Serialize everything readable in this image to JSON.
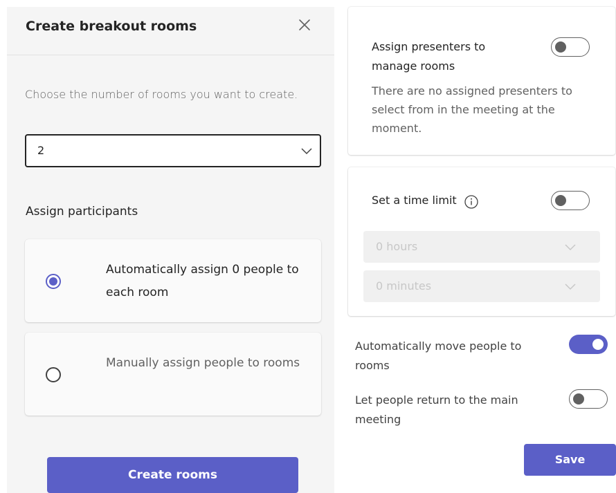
{
  "left_panel": {
    "title": "Create breakout rooms",
    "prompt": "Choose the number of rooms you want to create.",
    "room_count": "2",
    "assign_heading": "Assign participants",
    "options": [
      {
        "label": "Automatically assign 0 people to each room",
        "selected": true
      },
      {
        "label": "Manually assign people to rooms",
        "selected": false
      }
    ],
    "create_button": "Create rooms"
  },
  "right_panel": {
    "presenters": {
      "label": "Assign presenters to manage rooms",
      "enabled": false,
      "description": "There are no assigned presenters to select from in the meeting at the moment."
    },
    "time_limit": {
      "label": "Set a time limit",
      "enabled": false,
      "hours": "0 hours",
      "minutes": "0 minutes"
    },
    "auto_move": {
      "label": "Automatically move people to rooms",
      "enabled": true
    },
    "return_main": {
      "label": "Let people return to the main meeting",
      "enabled": false
    },
    "save_button": "Save"
  },
  "colors": {
    "accent": "#5b5fc7",
    "panel_bg": "#f5f5f5",
    "text_primary": "#242424",
    "text_secondary": "#616161",
    "disabled_bg": "#f0f0f0",
    "disabled_text": "#c7c7c7"
  },
  "icons": {
    "close": "close-icon",
    "chevron": "chevron-down-icon",
    "info": "info-icon"
  }
}
